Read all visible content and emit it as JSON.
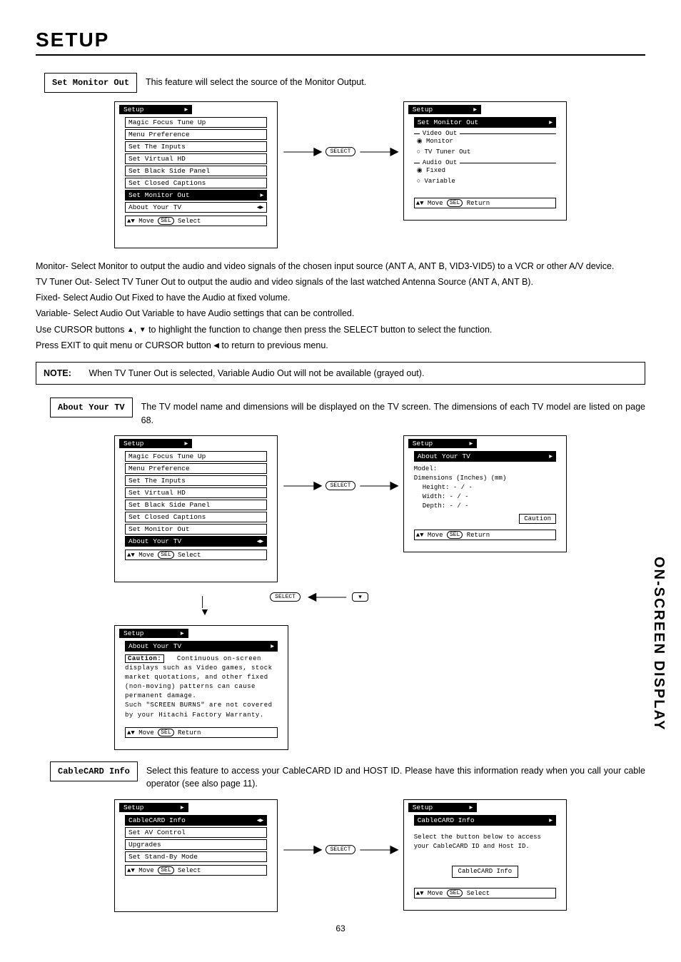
{
  "page": {
    "title": "SETUP",
    "number": "63",
    "side_tab": "ON-SCREEN DISPLAY"
  },
  "sections": {
    "monitor_out": {
      "label": "Set Monitor Out",
      "desc": "This feature will select the source of the Monitor Output."
    },
    "about_tv": {
      "label": "About Your TV",
      "desc": "The TV model name and dimensions will be displayed on the TV screen.  The dimensions of each TV model are listed on page 68."
    },
    "cablecard": {
      "label": "CableCARD Info",
      "desc": "Select this feature to access your CableCARD ID and HOST ID.  Please have this information ready when you call your cable operator (see also page 11)."
    }
  },
  "menus": {
    "setup_list": {
      "title": "Setup",
      "items": [
        "Magic Focus Tune Up",
        "Menu Preference",
        "Set The Inputs",
        "Set Virtual HD",
        "Set Black Side Panel",
        "Set Closed Captions",
        "Set Monitor Out",
        "About Your TV"
      ],
      "highlight_monitor": 6,
      "highlight_about": 7,
      "status": "Move",
      "status_action": "Select"
    },
    "monitor_out_detail": {
      "title": "Setup",
      "sub": "Set Monitor Out",
      "group1": "Video Out",
      "opt1a": "Monitor",
      "opt1b": "TV Tuner Out",
      "group2": "Audio Out",
      "opt2a": "Fixed",
      "opt2b": "Variable",
      "status": "Move",
      "status_action": "Return"
    },
    "about_detail": {
      "title": "Setup",
      "sub": "About Your TV",
      "l1": "Model:",
      "l2": "Dimensions  (Inches) (mm)",
      "l3": "Height:       - / -",
      "l4": "Width:        - / -",
      "l5": "Depth:        - / -",
      "caution": "Caution",
      "status": "Move",
      "status_action": "Return"
    },
    "caution_detail": {
      "title": "Setup",
      "sub": "About Your TV",
      "caution_label": "Caution:",
      "text": "Continuous on-screen displays such as Video games, stock market quotations, and other fixed (non-moving) patterns can cause permanent damage.\nSuch \"SCREEN BURNS\" are not covered by your Hitachi Factory Warranty.",
      "status": "Move",
      "status_action": "Return"
    },
    "cablecard_list": {
      "title": "Setup",
      "items": [
        "CableCARD Info",
        "Set AV Control",
        "Upgrades",
        "Set Stand-By Mode"
      ],
      "highlight": 0,
      "status": "Move",
      "status_action": "Select"
    },
    "cablecard_detail": {
      "title": "Setup",
      "sub": "CableCARD Info",
      "text1": "Select the button below to access",
      "text2": "your CableCARD ID and Host ID.",
      "button": "CableCARD Info",
      "status": "Move",
      "status_action": "Select"
    }
  },
  "select_label": "SELECT",
  "explain": {
    "p1": "Monitor- Select Monitor to output the audio and video signals of the chosen input source (ANT A, ANT B, VID3-VID5) to a VCR or other A/V device.",
    "p2": "TV Tuner Out- Select TV Tuner Out to output the audio and video signals of the last watched Antenna Source (ANT A, ANT B).",
    "p3": "Fixed-  Select Audio Out Fixed to have the Audio at fixed volume.",
    "p4": "Variable- Select Audio Out Variable to have Audio settings that can be controlled.",
    "p5a": "Use CURSOR buttons ",
    "p5b": ", ",
    "p5c": " to highlight the function to change then press the SELECT button to select the function.",
    "p6a": "Press EXIT to quit menu or CURSOR button ",
    "p6b": " to return to previous menu."
  },
  "note": {
    "label": "NOTE:",
    "text": "When TV Tuner Out is selected, Variable Audio Out will not be available (grayed out)."
  },
  "glyphs": {
    "up": "▲",
    "down": "▼",
    "left": "◀",
    "updown": "▲▼",
    "sel_ret": "SEL"
  }
}
